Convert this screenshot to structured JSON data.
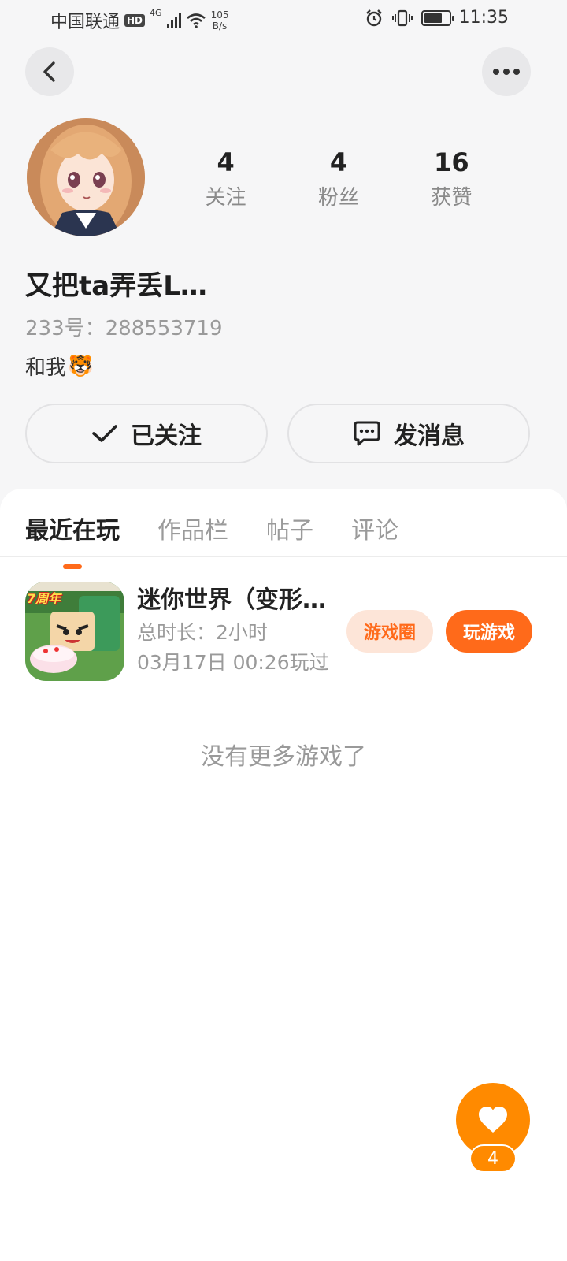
{
  "status_bar": {
    "carrier": "中国联通",
    "hd_badge": "HD",
    "network": "4G",
    "speed_value": "105",
    "speed_unit": "B/s",
    "time": "11:35"
  },
  "profile": {
    "stats": [
      {
        "value": "4",
        "label": "关注"
      },
      {
        "value": "4",
        "label": "粉丝"
      },
      {
        "value": "16",
        "label": "获赞"
      }
    ],
    "username": "又把ta弄丢L…",
    "id_text": "233号：288553719",
    "bio_text": "和我",
    "bio_emoji": "🐯"
  },
  "actions": {
    "follow_label": "已关注",
    "message_label": "发消息"
  },
  "tabs": [
    {
      "label": "最近在玩",
      "active": true
    },
    {
      "label": "作品栏",
      "active": false
    },
    {
      "label": "帖子",
      "active": false
    },
    {
      "label": "评论",
      "active": false
    }
  ],
  "games": [
    {
      "title": "迷你世界（变形…",
      "total_time": "总时长：2小时",
      "last_played": "03月17日 00:26玩过",
      "circle_label": "游戏圈",
      "play_label": "玩游戏",
      "icon_badge": "7周年"
    }
  ],
  "empty_text": "没有更多游戏了",
  "fab": {
    "count": "4"
  },
  "colors": {
    "accent": "#ff6a1a",
    "fab": "#ff8a00",
    "background": "#f6f6f7"
  },
  "icons": [
    "back-icon",
    "more-icon",
    "check-icon",
    "message-icon",
    "heart-icon",
    "wifi-icon",
    "alarm-icon",
    "vibrate-icon",
    "battery-icon"
  ]
}
